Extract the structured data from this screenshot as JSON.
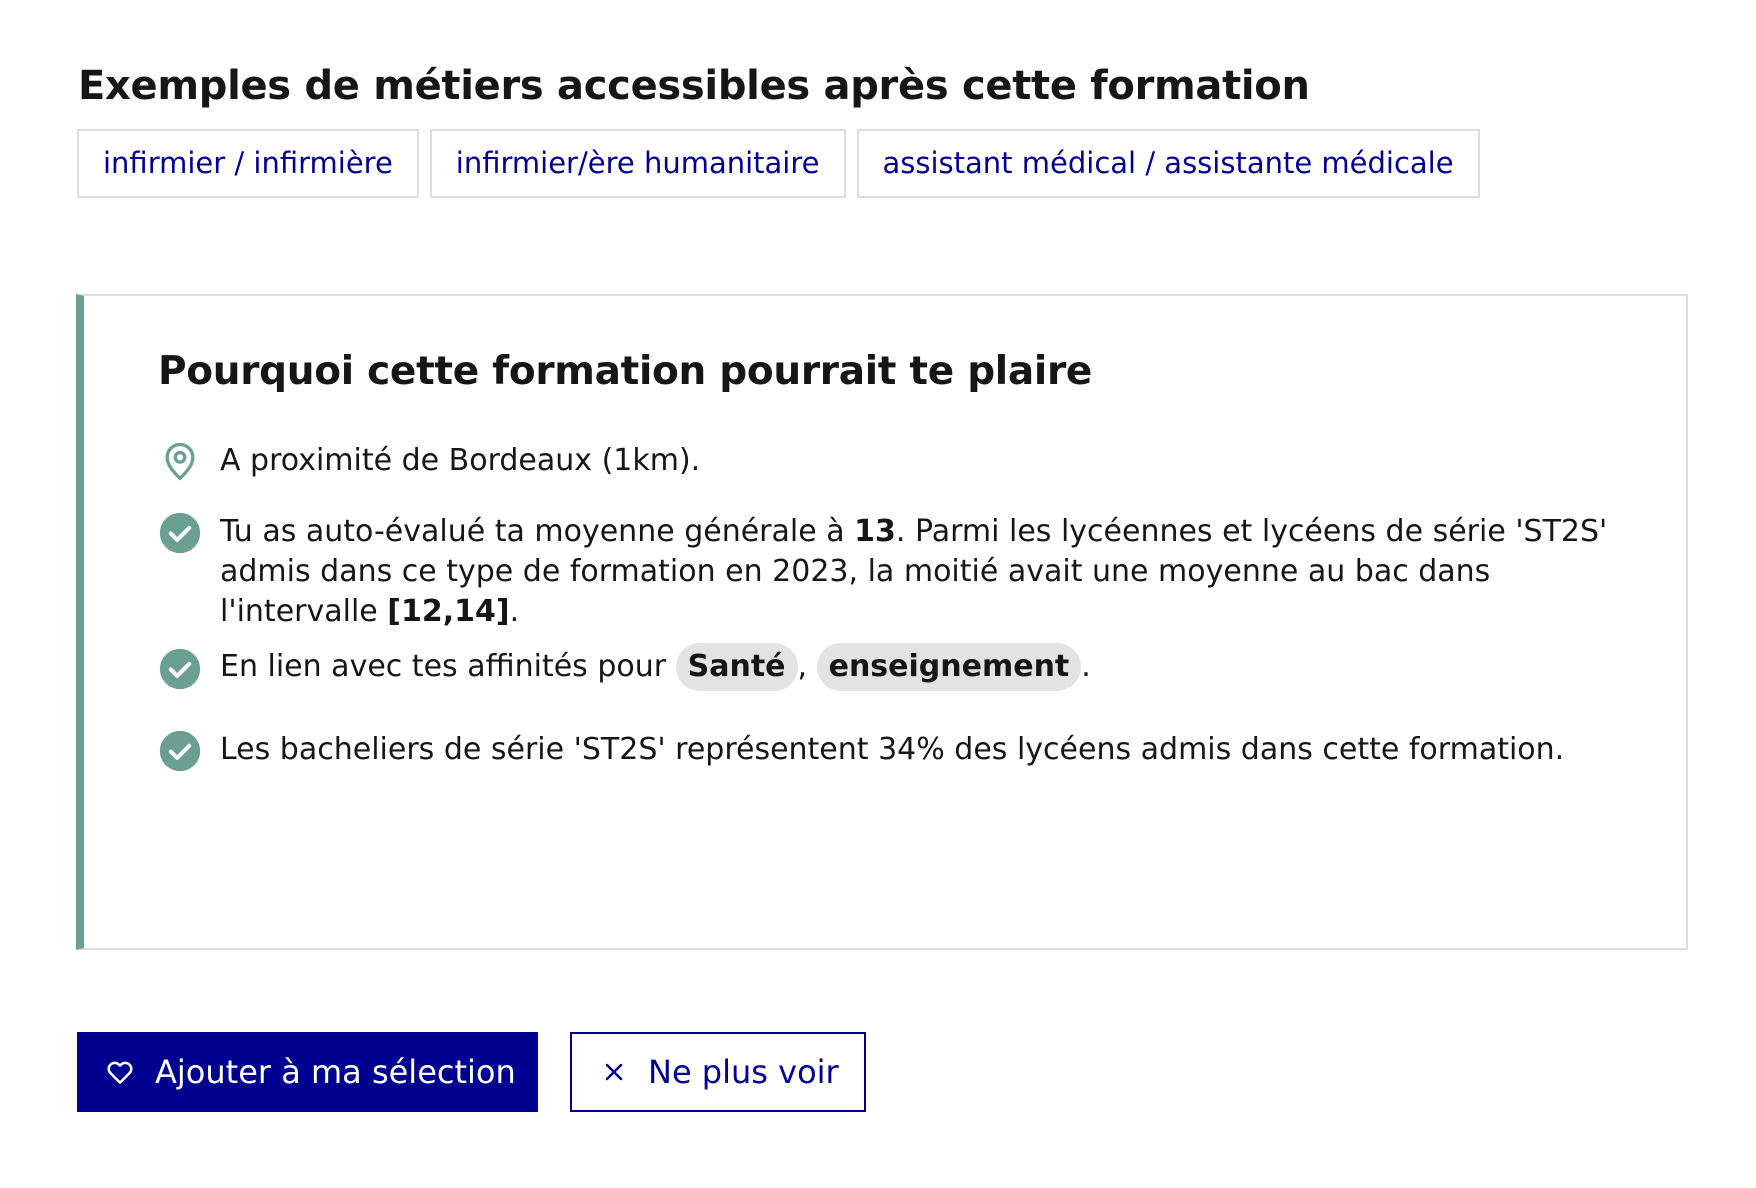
{
  "jobs_section": {
    "title": "Exemples de métiers accessibles après cette formation",
    "tags": [
      "infirmier / infirmière",
      "infirmier/ère humanitaire",
      "assistant médical / assistante médicale"
    ]
  },
  "why_section": {
    "title": "Pourquoi cette formation pourrait te plaire",
    "accent_color": "#6a9f92",
    "reasons": {
      "location": {
        "icon": "map-pin-icon",
        "text": "A proximité de Bordeaux (1km)."
      },
      "grades": {
        "icon": "check-circle-icon",
        "part1": "Tu as auto-évalué ta moyenne générale à ",
        "grade": "13",
        "part2": ". Parmi les lycéennes et lycéens de série 'ST2S' admis dans ce type de formation en 2023, la moitié avait une moyenne au bac dans l'intervalle ",
        "interval": "[12,14]",
        "part3": "."
      },
      "affinities": {
        "icon": "check-circle-icon",
        "prefix": "En lien avec tes affinités pour ",
        "chips": [
          "Santé",
          "enseignement"
        ],
        "separator": ", ",
        "suffix": "."
      },
      "bac_series": {
        "icon": "check-circle-icon",
        "text": "Les bacheliers de série 'ST2S' représentent 34% des lycéens admis dans cette formation."
      }
    }
  },
  "actions": {
    "add_label": "Ajouter à ma sélection",
    "add_icon": "heart-icon",
    "hide_label": "Ne plus voir",
    "hide_icon": "close-icon",
    "primary_color": "#000091"
  }
}
